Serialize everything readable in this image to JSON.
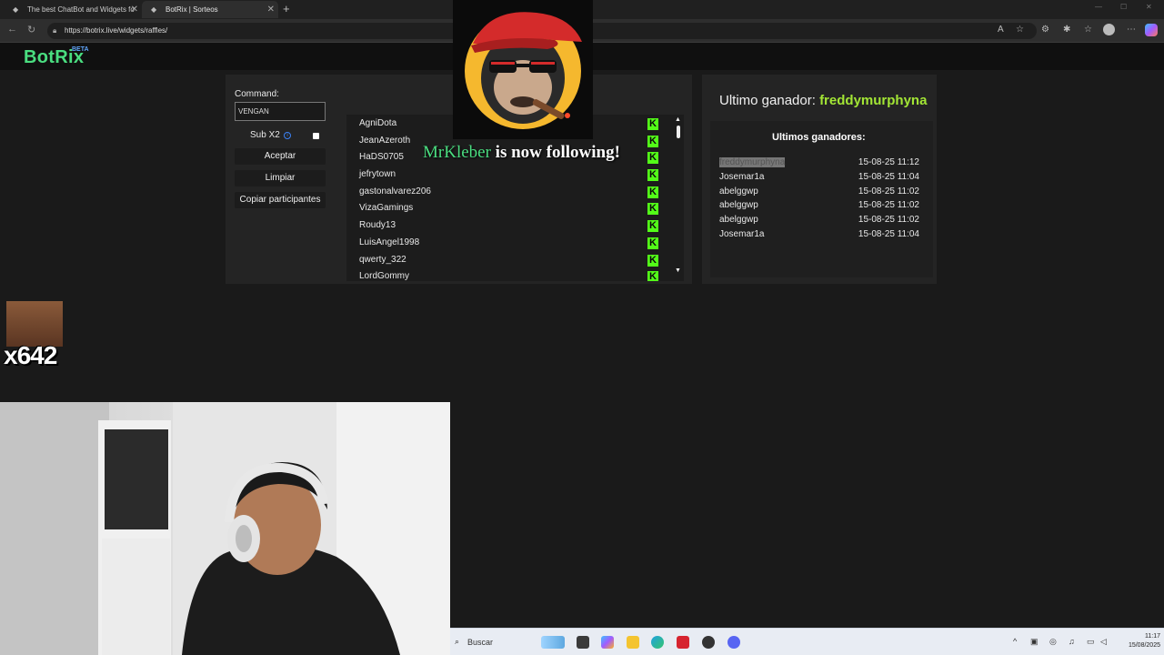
{
  "browser": {
    "tabs": [
      {
        "title": "The best ChatBot and Widgets fo",
        "active": false
      },
      {
        "title": "BotRix | Sorteos",
        "active": true
      }
    ],
    "url": "https://botrix.live/widgets/raffles/",
    "tab_close_glyph": "✕",
    "new_tab_glyph": "+"
  },
  "site": {
    "logo": "BotRix",
    "beta_badge": "BETA"
  },
  "raffle": {
    "command_label": "Command:",
    "command_value": "VENGAN",
    "sub_label": "Sub X2",
    "sub_checked": false,
    "buttons": {
      "accept": "Aceptar",
      "clear": "Limpiar",
      "copy": "Copiar participantes"
    },
    "participants": [
      "AgniDota",
      "JeanAzeroth",
      "HaDS0705",
      "jefrytown",
      "gastonalvarez206",
      "VizaGamings",
      "Roudy13",
      "LuisAngel1998",
      "qwerty_322",
      "LordGommy"
    ],
    "platform_icon": "kick-icon",
    "platform_color": "#53fc18"
  },
  "winners": {
    "last_winner_label": "Ultimo ganador:",
    "last_winner": "freddymurphyna",
    "history_title": "Ultimos ganadores:",
    "history": [
      {
        "name": "freddymurphyna",
        "date": "15-08-25 11:12",
        "selected": true
      },
      {
        "name": "Josemar1a",
        "date": "15-08-25 11:04",
        "selected": false
      },
      {
        "name": "abelggwp",
        "date": "15-08-25 11:02",
        "selected": false
      },
      {
        "name": "abelggwp",
        "date": "15-08-25 11:02",
        "selected": false
      },
      {
        "name": "abelggwp",
        "date": "15-08-25 11:02",
        "selected": false
      },
      {
        "name": "Josemar1a",
        "date": "15-08-25 11:04",
        "selected": false
      }
    ]
  },
  "overlay": {
    "follow_user": "MrKleber",
    "follow_text": "is now following!",
    "emote_count": "x642"
  },
  "taskbar": {
    "search_placeholder": "Buscar",
    "time": "11:17",
    "date": "15/08/2025"
  },
  "colors": {
    "accent_green": "#4ade80",
    "winner_green": "#a3e635",
    "kick_green": "#53fc18",
    "beta_blue": "#60a5fa"
  }
}
